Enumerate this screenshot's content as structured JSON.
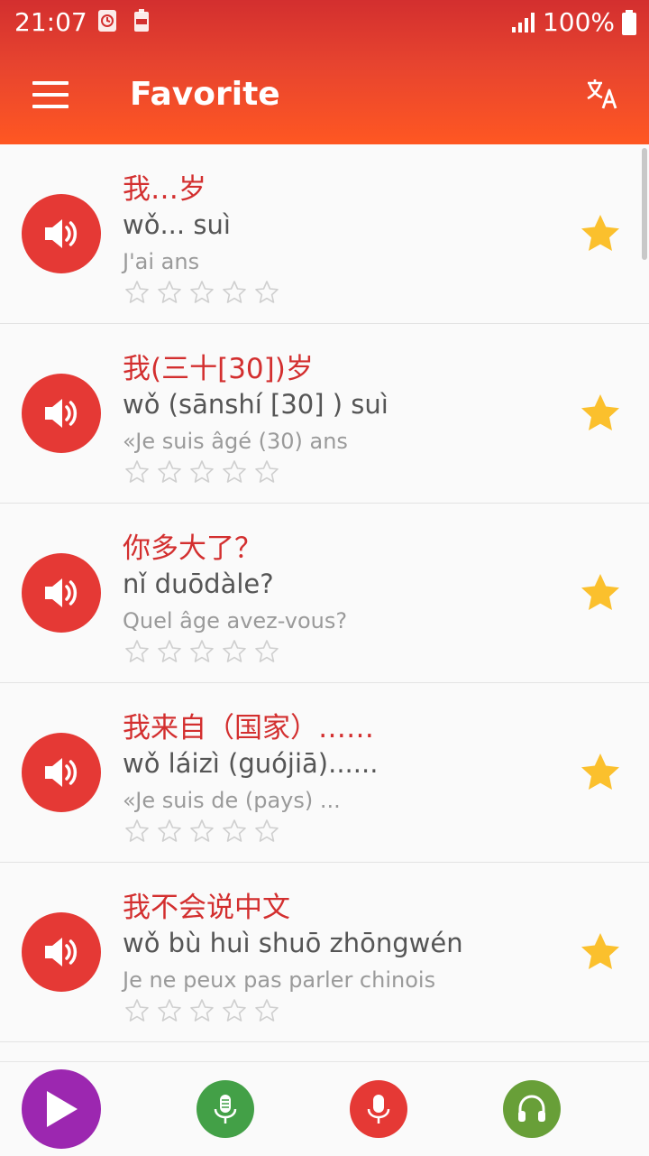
{
  "status_bar": {
    "time": "21:07",
    "battery_text": "100%"
  },
  "app_bar": {
    "title": "Favorite"
  },
  "phrases": [
    {
      "chinese": "我…岁",
      "pinyin": "wǒ... suì",
      "french": "J'ai ans",
      "rating": 0,
      "favorite": true
    },
    {
      "chinese": "我(三十[30])岁",
      "pinyin": "wǒ (sānshí [30] ) suì",
      "french": "«Je suis âgé (30) ans",
      "rating": 0,
      "favorite": true
    },
    {
      "chinese": "你多大了？",
      "pinyin": "nǐ duōdàle?",
      "french": "Quel âge avez-vous?",
      "rating": 0,
      "favorite": true
    },
    {
      "chinese": "我来自（国家）……",
      "pinyin": "wǒ láizì (guójiā)......",
      "french": "«Je suis de (pays) ...",
      "rating": 0,
      "favorite": true
    },
    {
      "chinese": "我不会说中文",
      "pinyin": "wǒ bù huì shuō zhōngwén",
      "french": "Je ne peux pas parler chinois",
      "rating": 0,
      "favorite": true
    }
  ],
  "colors": {
    "accent": "#e53935",
    "star_favorite": "#fbc02d",
    "play_button": "#9c27b0",
    "mic_button": "#43a047",
    "record_button": "#e53935",
    "listen_button": "#689f38"
  },
  "bottom_bar": {
    "icons": [
      "play-icon",
      "microphone-icon",
      "record-microphone-icon",
      "headphones-icon"
    ]
  }
}
